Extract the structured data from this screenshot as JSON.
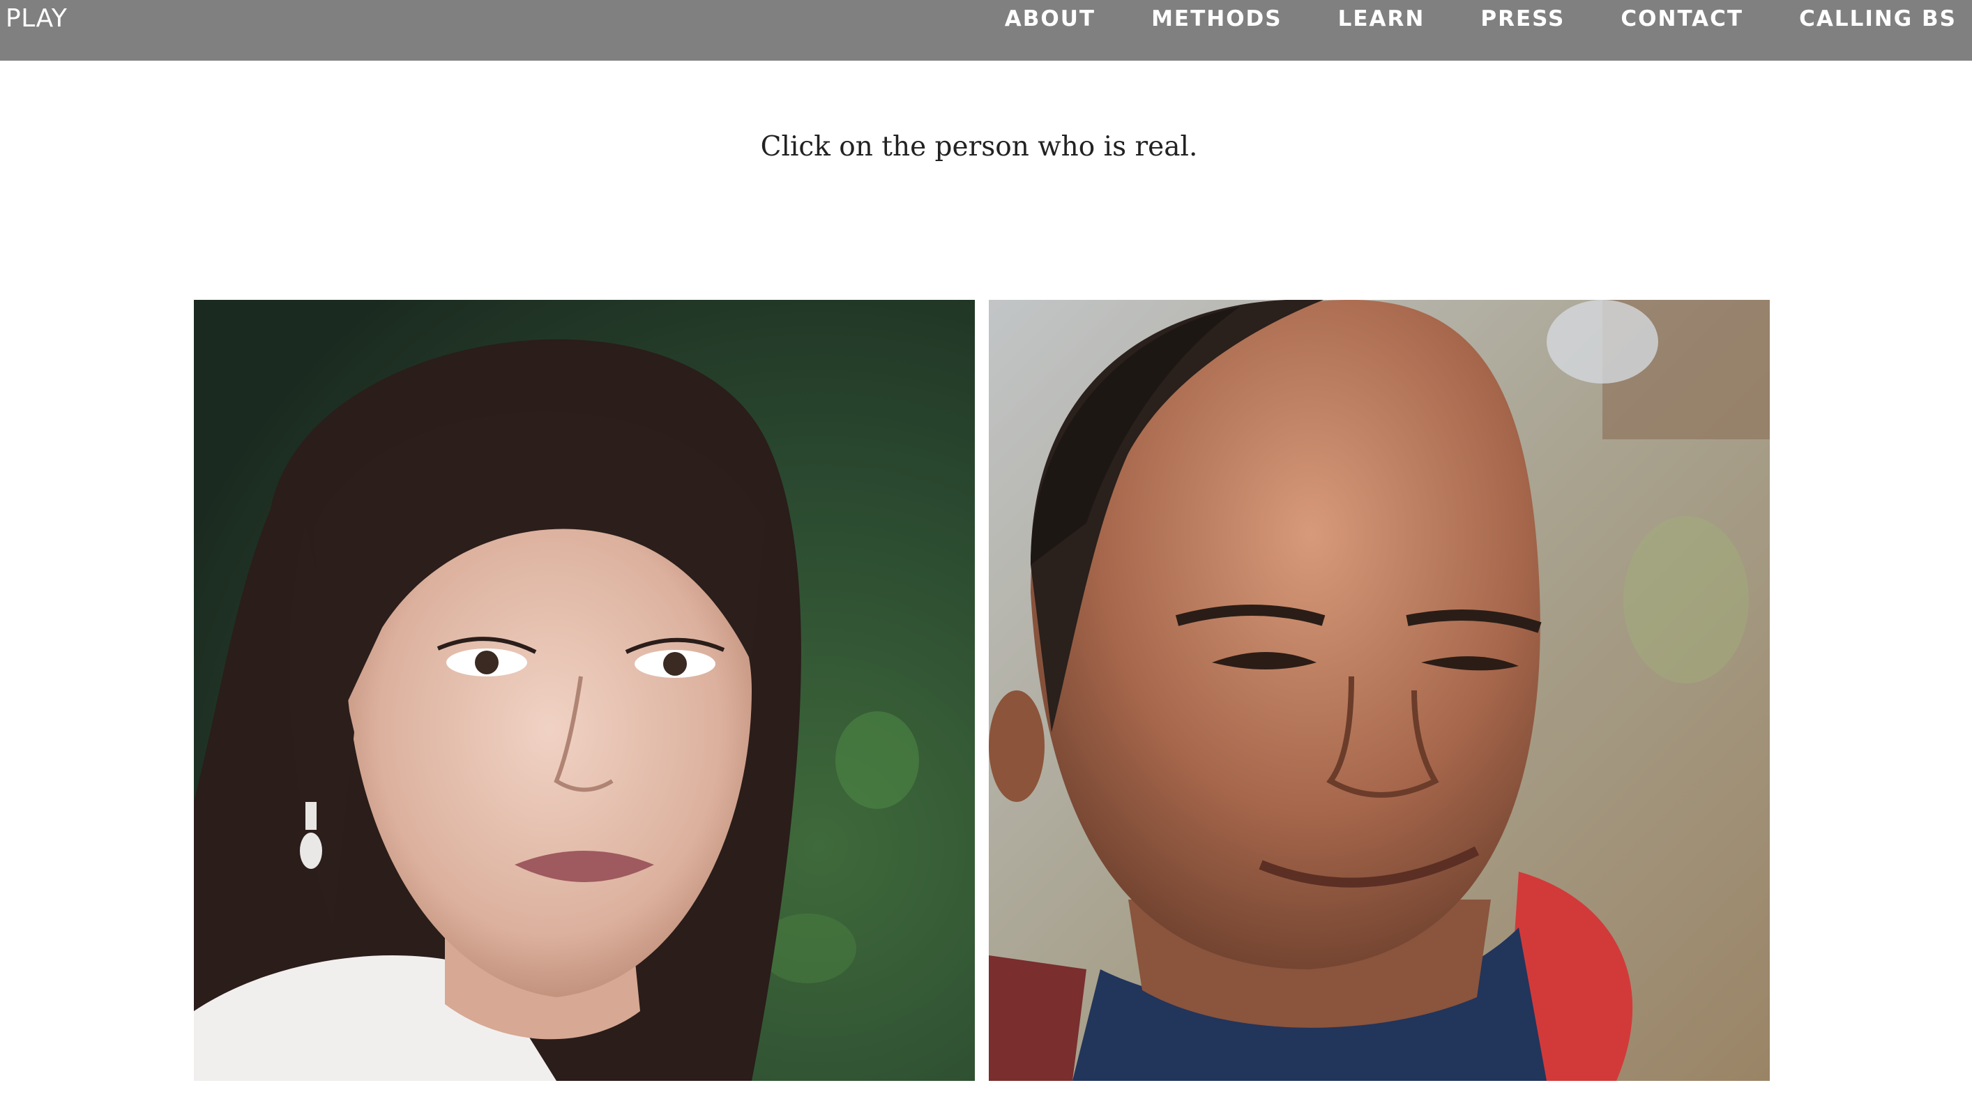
{
  "header": {
    "brand": "PLAY",
    "nav": [
      "ABOUT",
      "METHODS",
      "LEARN",
      "PRESS",
      "CONTACT",
      "CALLING BS"
    ]
  },
  "main": {
    "prompt": "Click on the person who is real."
  },
  "colors": {
    "nav_bar": "#808080",
    "nav_text": "#ffffff",
    "page_background": "#ffffff",
    "prompt_text": "#222222"
  }
}
